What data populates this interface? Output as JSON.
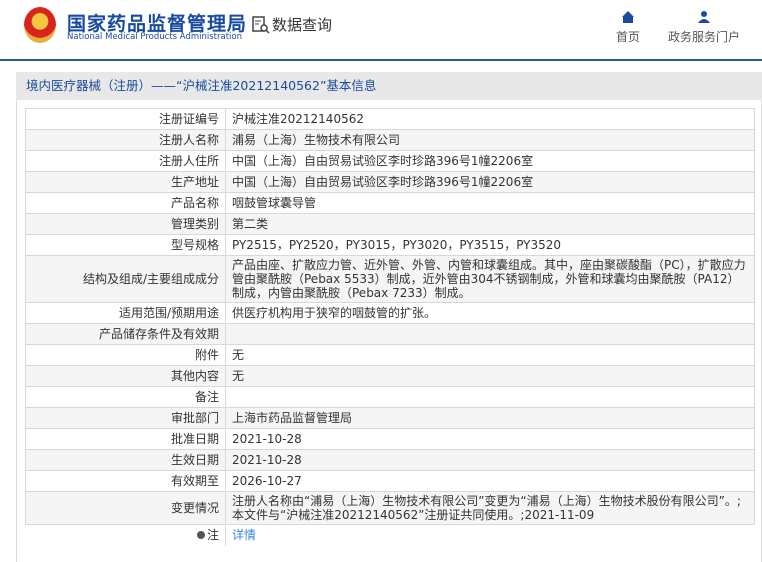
{
  "header": {
    "brand_cn": "国家药品监督管理局",
    "brand_en": "National Medical Products Administration",
    "data_query": "数据查询",
    "nav": [
      {
        "label": "首页",
        "icon": "home-icon"
      },
      {
        "label": "政务服务门户",
        "icon": "user-icon"
      }
    ]
  },
  "title": "境内医疗器械（注册）——“沪械注准20212140562”基本信息",
  "rows": [
    {
      "label": "注册证编号",
      "value": "沪械注准20212140562"
    },
    {
      "label": "注册人名称",
      "value": "浦易（上海）生物技术有限公司"
    },
    {
      "label": "注册人住所",
      "value": "中国（上海）自由贸易试验区李时珍路396号1幢2206室"
    },
    {
      "label": "生产地址",
      "value": "中国（上海）自由贸易试验区李时珍路396号1幢2206室"
    },
    {
      "label": "产品名称",
      "value": "咽鼓管球囊导管"
    },
    {
      "label": "管理类别",
      "value": "第二类"
    },
    {
      "label": "型号规格",
      "value": "PY2515，PY2520，PY3015，PY3020，PY3515，PY3520"
    },
    {
      "label": "结构及组成/主要组成成分",
      "value": "产品由座、扩散应力管、近外管、外管、内管和球囊组成。其中，座由聚碳酸酯（PC），扩散应力管由聚酰胺（Pebax 5533）制成，近外管由304不锈钢制成，外管和球囊均由聚酰胺（PA12）制成，内管由聚酰胺（Pebax 7233）制成。"
    },
    {
      "label": "适用范围/预期用途",
      "value": "供医疗机构用于狭窄的咽鼓管的扩张。"
    },
    {
      "label": "产品储存条件及有效期",
      "value": ""
    },
    {
      "label": "附件",
      "value": "无"
    },
    {
      "label": "其他内容",
      "value": "无"
    },
    {
      "label": "备注",
      "value": ""
    },
    {
      "label": "审批部门",
      "value": "上海市药品监督管理局"
    },
    {
      "label": "批准日期",
      "value": "2021-10-28"
    },
    {
      "label": "生效日期",
      "value": "2021-10-28"
    },
    {
      "label": "有效期至",
      "value": "2026-10-27"
    },
    {
      "label": "变更情况",
      "value": "注册人名称由“浦易（上海）生物技术有限公司”变更为“浦易（上海）生物技术股份有限公司”。;本文件与“沪械注准20212140562”注册证共同使用。;2021-11-09"
    }
  ],
  "note": {
    "label": "注",
    "link": "详情"
  }
}
